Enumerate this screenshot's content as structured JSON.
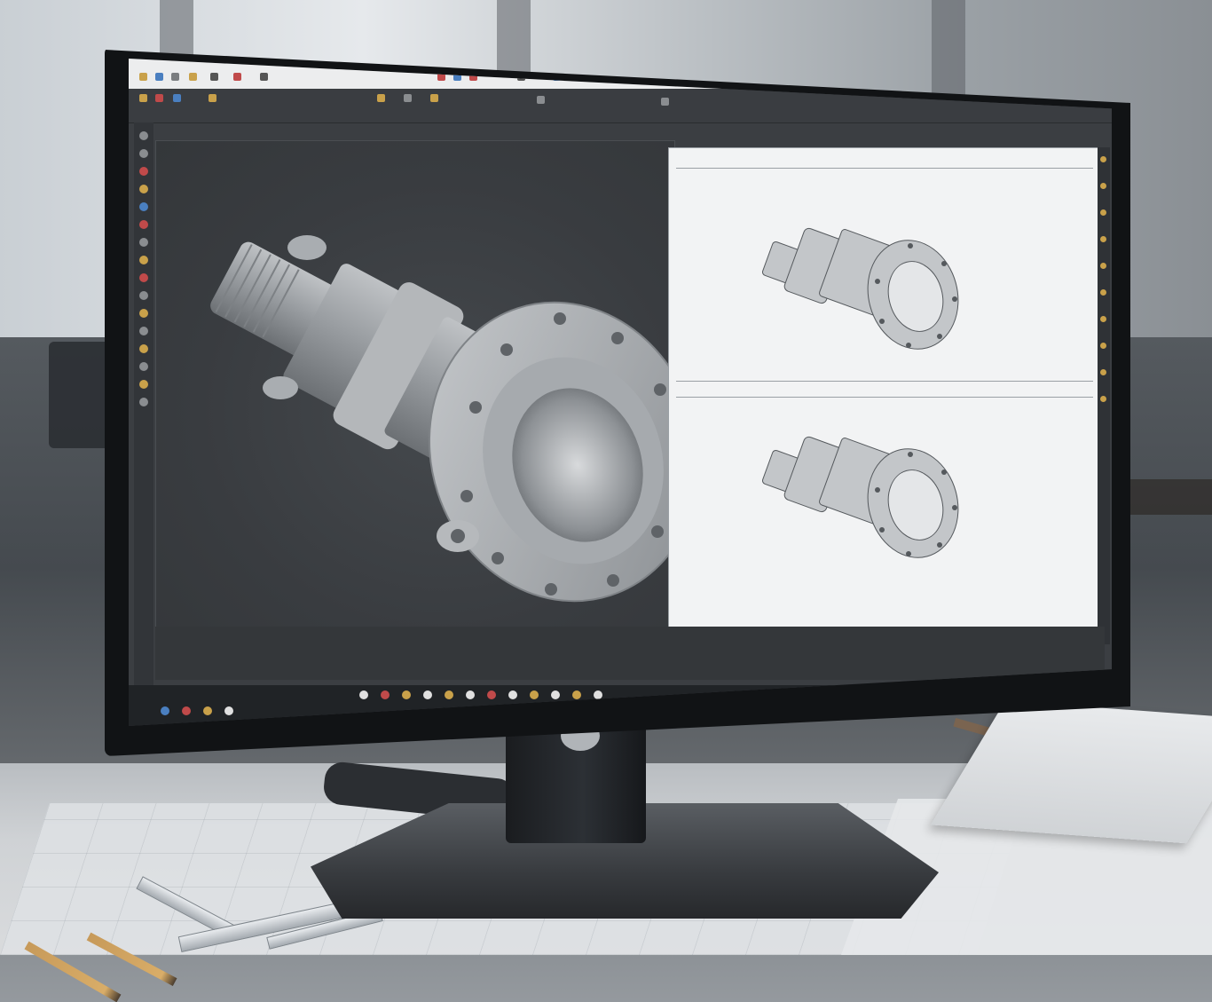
{
  "scene": {
    "description_labels": {
      "monitor_brand": "",
      "window_title": "",
      "viewport_tab": "",
      "drawing_title": "",
      "drawing_subtitle_1": "",
      "drawing_subtitle_2": "",
      "drawing_section_2": "",
      "drawing_section_2_sub": "",
      "bottom_panel_title": "",
      "bottom_panel_item_1": "",
      "bottom_panel_item_2": "",
      "taskbar_status": ""
    },
    "colors": {
      "viewport_bg": "#393c40",
      "drawing_bg": "#f2f3f4",
      "part_light": "#c9cbce",
      "part_mid": "#9da1a5",
      "part_dark": "#6d7175",
      "accent_icon": "#c9a14a"
    },
    "icons": [
      "toolbar-icons",
      "ribbon-icons",
      "sidebar-icons",
      "taskbar-icons"
    ]
  }
}
